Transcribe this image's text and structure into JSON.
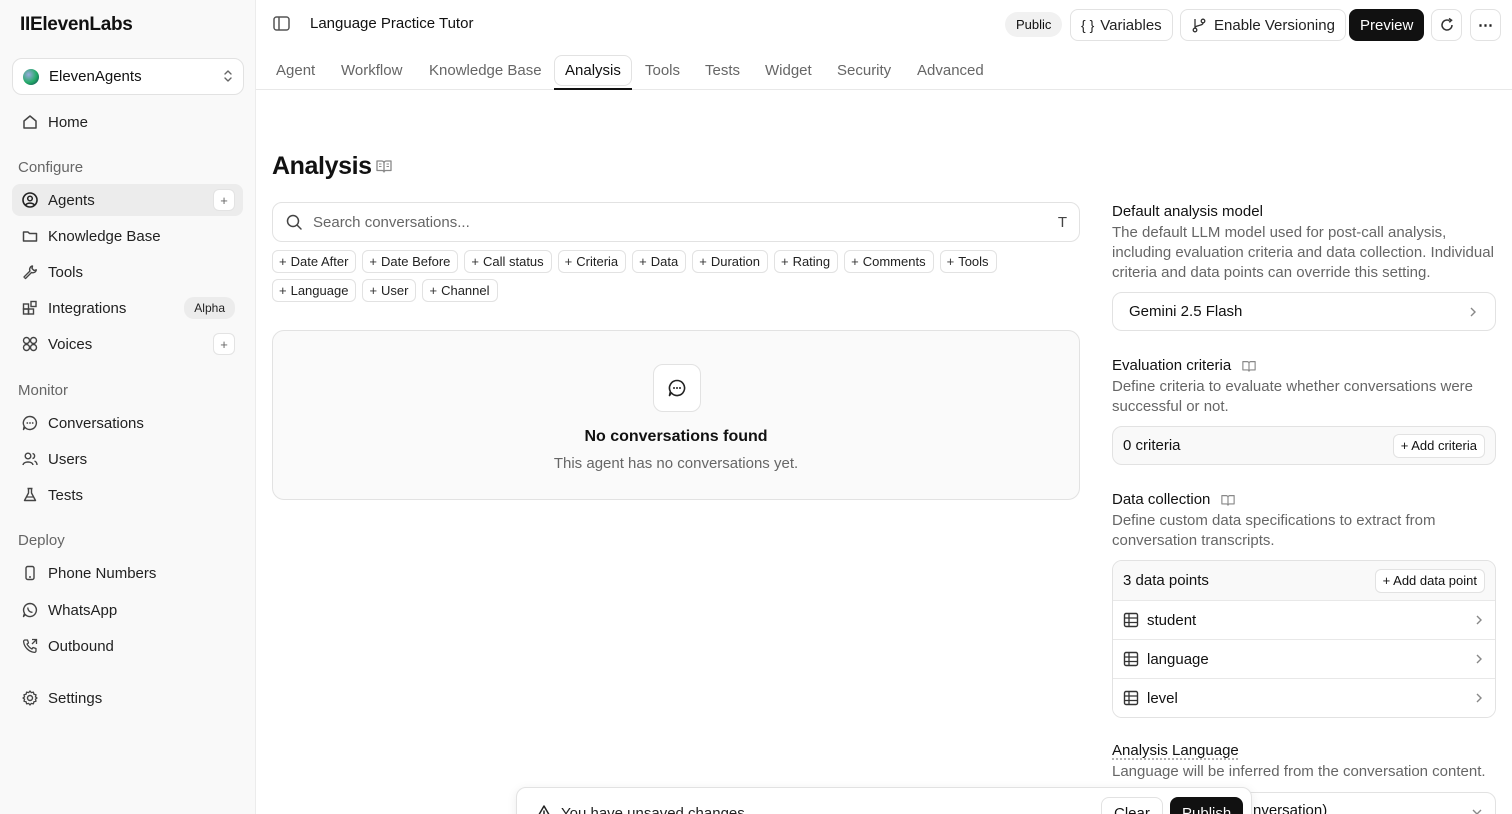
{
  "app": {
    "logo": "IIElevenLabs",
    "workspace": "ElevenAgents"
  },
  "sidebar": {
    "home": "Home",
    "configure_label": "Configure",
    "configure": [
      {
        "label": "Agents"
      },
      {
        "label": "Knowledge Base"
      },
      {
        "label": "Tools"
      },
      {
        "label": "Integrations",
        "badge": "Alpha"
      },
      {
        "label": "Voices"
      }
    ],
    "monitor_label": "Monitor",
    "monitor": [
      {
        "label": "Conversations"
      },
      {
        "label": "Users"
      },
      {
        "label": "Tests"
      }
    ],
    "deploy_label": "Deploy",
    "deploy": [
      {
        "label": "Phone Numbers"
      },
      {
        "label": "WhatsApp"
      },
      {
        "label": "Outbound"
      }
    ],
    "settings": "Settings",
    "add_symbol": "+"
  },
  "header": {
    "title": "Language Practice Tutor",
    "public_badge": "Public",
    "variables": "Variables",
    "variables_glyph": "{ }",
    "versioning": "Enable Versioning",
    "preview": "Preview",
    "more": "⋯"
  },
  "tabs": [
    "Agent",
    "Workflow",
    "Knowledge Base",
    "Analysis",
    "Tools",
    "Tests",
    "Widget",
    "Security",
    "Advanced"
  ],
  "main": {
    "heading": "Analysis",
    "search_placeholder": "Search conversations...",
    "text_cursor_glyph": "T",
    "chip_plus": "+",
    "filters": [
      "Date After",
      "Date Before",
      "Call status",
      "Criteria",
      "Data",
      "Duration",
      "Rating",
      "Comments",
      "Tools",
      "Language",
      "User",
      "Channel"
    ],
    "empty_title": "No conversations found",
    "empty_sub": "This agent has no conversations yet."
  },
  "right": {
    "model_heading": "Default analysis model",
    "model_desc": "The default LLM model used for post-call analysis, including evaluation criteria and data collection. Individual criteria and data points can override this setting.",
    "model_value": "Gemini 2.5 Flash",
    "eval_heading": "Evaluation criteria",
    "eval_desc": "Define criteria to evaluate whether conversations were successful or not.",
    "eval_count": "0 criteria",
    "eval_add": "+ Add criteria",
    "data_heading": "Data collection",
    "data_desc": "Define custom data specifications to extract from conversation transcripts.",
    "data_count": "3 data points",
    "data_add": "+ Add data point",
    "data_points": [
      "student",
      "language",
      "level"
    ],
    "lang_heading": "Analysis Language",
    "lang_desc": "Language will be inferred from the conversation content.",
    "lang_value_partial": "nversation)"
  },
  "toast": {
    "message": "You have unsaved changes",
    "clear": "Clear",
    "publish": "Publish"
  }
}
